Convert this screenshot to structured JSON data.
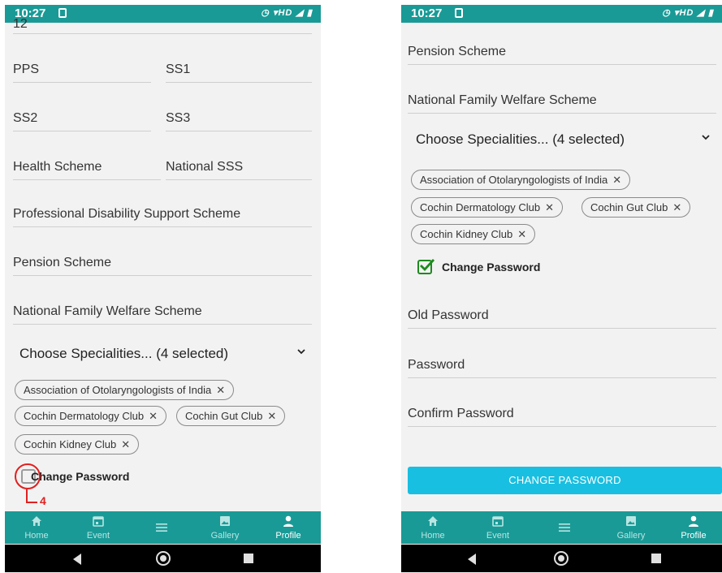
{
  "status_bar": {
    "time": "10:27",
    "icons": "◷ ▾HD ◢ ▮"
  },
  "left": {
    "partial_value": "12",
    "fields": {
      "pps": "PPS",
      "ss1": "SS1",
      "ss2": "SS2",
      "ss3": "SS3",
      "health_scheme": "Health Scheme",
      "national_sss": "National SSS",
      "professional_disability": "Professional Disability Support Scheme",
      "pension_scheme": "Pension Scheme",
      "national_family_welfare": "National Family Welfare Scheme"
    },
    "dropdown_label": "Choose Specialities... (4 selected)",
    "chips": [
      "Association of Otolaryngologists of India",
      "Cochin Dermatology Club",
      "Cochin Gut Club",
      "Cochin Kidney Club"
    ],
    "change_password_label": "Change Password",
    "change_password_checked": false,
    "annotation_number": "4"
  },
  "right": {
    "fields": {
      "pension_scheme": "Pension Scheme",
      "national_family_welfare": "National Family Welfare Scheme",
      "old_password": "Old Password",
      "password": "Password",
      "confirm_password": "Confirm Password"
    },
    "dropdown_label": "Choose Specialities... (4 selected)",
    "chips": [
      "Association of Otolaryngologists of India",
      "Cochin Dermatology Club",
      "Cochin Gut Club",
      "Cochin Kidney Club"
    ],
    "change_password_label": "Change Password",
    "change_password_checked": true,
    "change_password_button": "CHANGE PASSWORD"
  },
  "bottom_nav": {
    "items": [
      {
        "label": "Home",
        "icon": "home-icon"
      },
      {
        "label": "Event",
        "icon": "calendar-icon"
      },
      {
        "label": "",
        "icon": "menu-icon"
      },
      {
        "label": "Gallery",
        "icon": "gallery-icon"
      },
      {
        "label": "Profile",
        "icon": "person-icon"
      }
    ],
    "active": "Profile"
  },
  "colors": {
    "teal": "#1a9a96",
    "button": "#19bfe0",
    "annotation": "#e02020",
    "check": "#1e8a1e"
  }
}
